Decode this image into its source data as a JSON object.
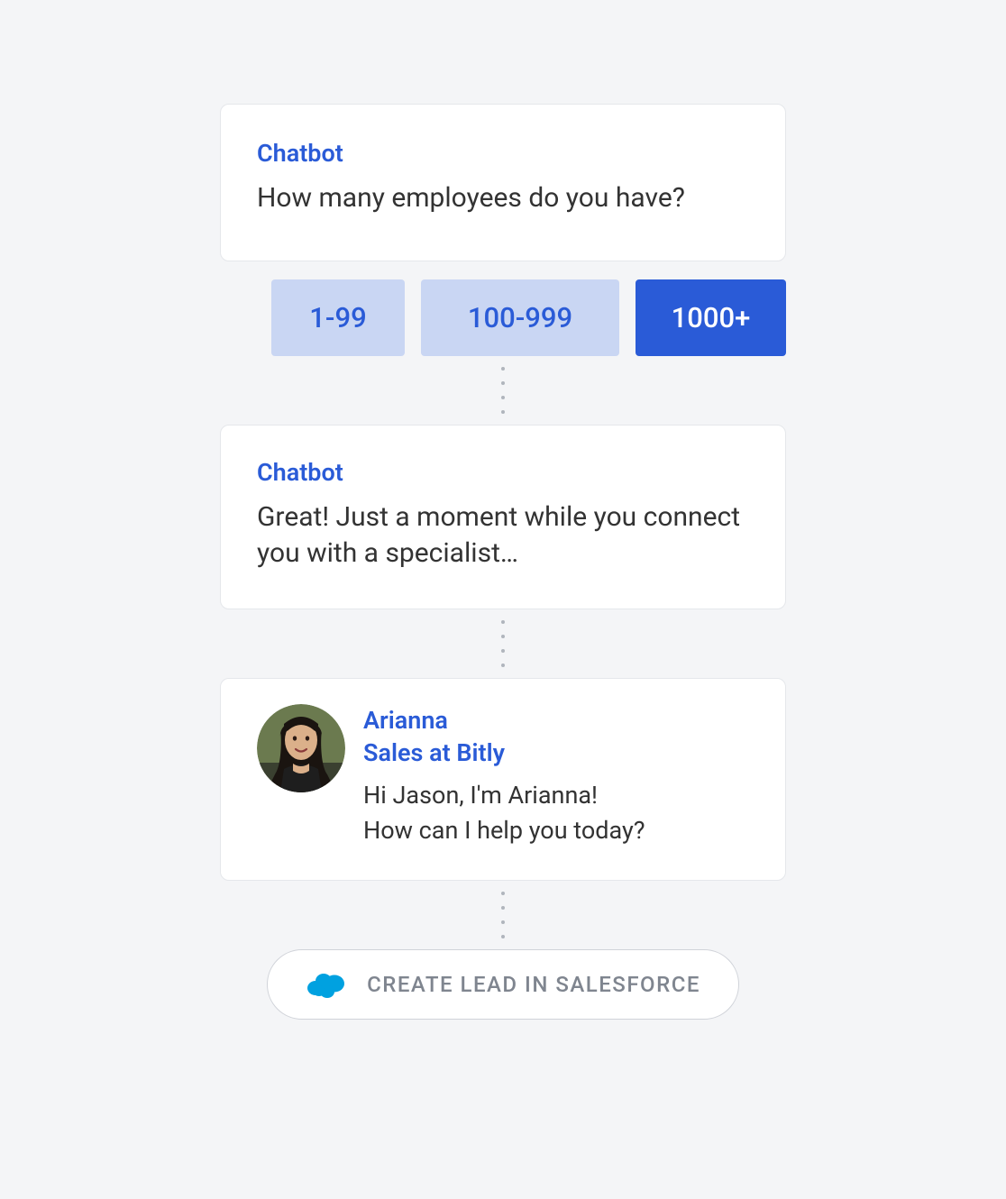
{
  "messages": {
    "first": {
      "sender": "Chatbot",
      "text": "How many employees do you have?"
    },
    "options": [
      {
        "label": "1-99",
        "selected": false
      },
      {
        "label": "100-999",
        "selected": false
      },
      {
        "label": "1000+",
        "selected": true
      }
    ],
    "second": {
      "sender": "Chatbot",
      "text": "Great! Just a moment while you connect you with a specialist…"
    },
    "agent": {
      "name": "Arianna",
      "role": "Sales at Bitly",
      "text_line1": "Hi Jason, I'm Arianna!",
      "text_line2": "How can I help you today?"
    }
  },
  "action": {
    "label": "CREATE LEAD IN SALESFORCE"
  }
}
